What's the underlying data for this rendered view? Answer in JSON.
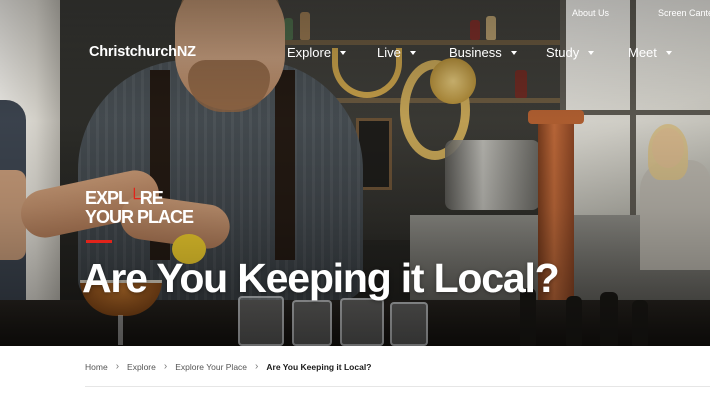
{
  "topbar": {
    "about": "About Us",
    "screen_centre": "Screen Canter"
  },
  "brand": {
    "logo": "ChristchurchNZ",
    "campaign_line1_a": "EXPL",
    "campaign_line1_mark": "└",
    "campaign_line1_b": "RE",
    "campaign_line2": "YOUR PLACE",
    "accent_color": "#e2231a"
  },
  "nav": {
    "items": [
      {
        "label": "Explore"
      },
      {
        "label": "Live"
      },
      {
        "label": "Business"
      },
      {
        "label": "Study"
      },
      {
        "label": "Meet"
      }
    ]
  },
  "hero": {
    "title": "Are You Keeping it Local?"
  },
  "breadcrumb": {
    "items": [
      {
        "label": "Home"
      },
      {
        "label": "Explore"
      },
      {
        "label": "Explore Your Place"
      }
    ],
    "current": "Are You Keeping it Local?",
    "separator": "›"
  }
}
